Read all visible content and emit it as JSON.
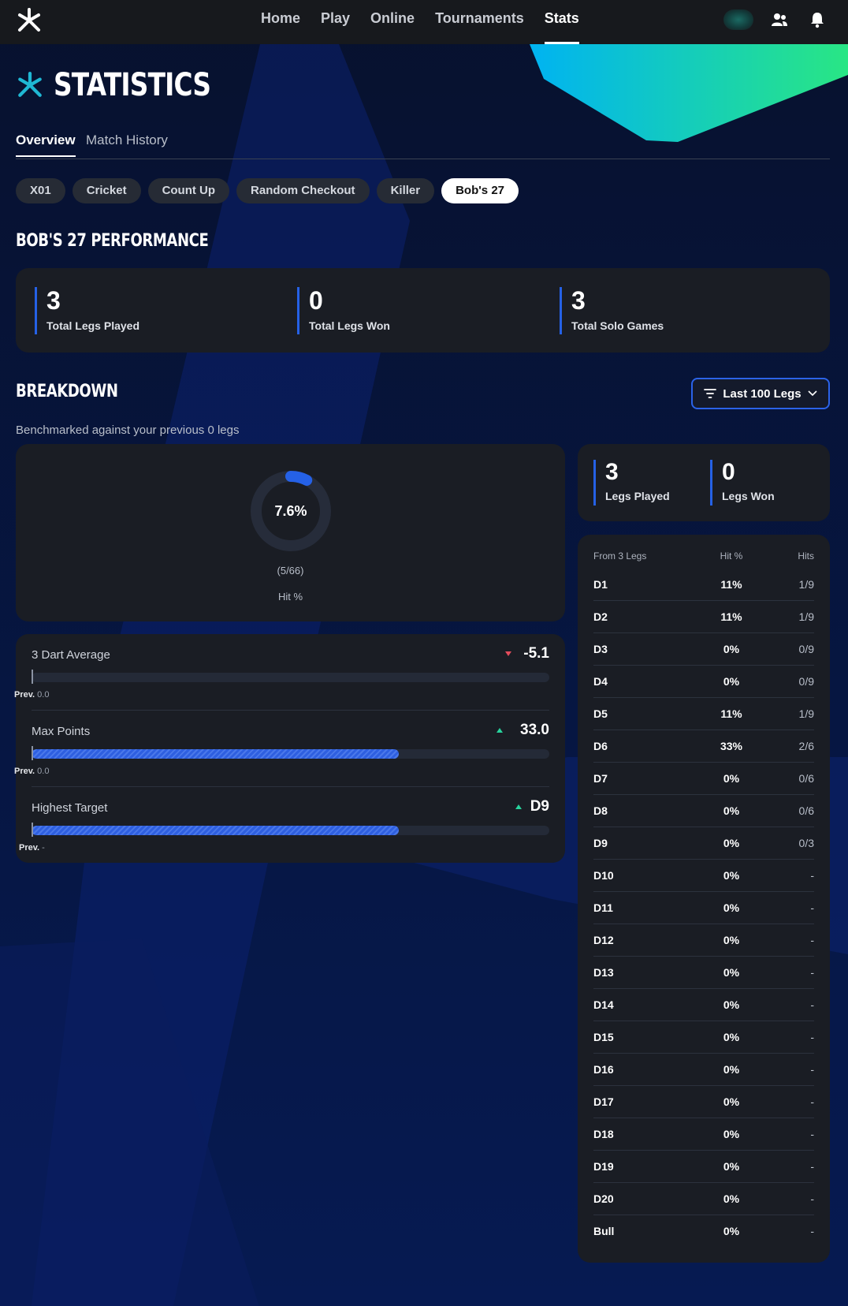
{
  "nav": {
    "items": [
      "Home",
      "Play",
      "Online",
      "Tournaments",
      "Stats"
    ],
    "active": "Stats",
    "icons": [
      "friends-icon",
      "bell-icon"
    ]
  },
  "page": {
    "title": "STATISTICS",
    "tabs": [
      "Overview",
      "Match History"
    ],
    "active_tab": "Overview",
    "game_chips": [
      "X01",
      "Cricket",
      "Count Up",
      "Random Checkout",
      "Killer",
      "Bob's 27"
    ],
    "active_chip": "Bob's 27"
  },
  "performance": {
    "title": "BOB'S 27 PERFORMANCE",
    "stats": [
      {
        "value": "3",
        "label": "Total Legs Played"
      },
      {
        "value": "0",
        "label": "Total Legs Won"
      },
      {
        "value": "3",
        "label": "Total Solo Games"
      }
    ]
  },
  "breakdown": {
    "title": "BREAKDOWN",
    "filter_label": "Last 100 Legs",
    "benchmark_text": "Benchmarked against your previous 0 legs",
    "hit_ring": {
      "percent_label": "7.6%",
      "fraction": 0.076,
      "count_label": "(5/66)",
      "caption": "Hit %"
    },
    "metrics": [
      {
        "name": "3 Dart Average",
        "value": "-5.1",
        "trend": "down",
        "fill": 0,
        "prev_label": "Prev.",
        "prev_value": "0.0"
      },
      {
        "name": "Max Points",
        "value": "33.0",
        "trend": "up",
        "fill": 0.71,
        "prev_label": "Prev.",
        "prev_value": "0.0"
      },
      {
        "name": "Highest Target",
        "value": "D9",
        "trend": "up",
        "fill": 0.71,
        "prev_label": "Prev.",
        "prev_value": "-"
      }
    ],
    "legs": [
      {
        "value": "3",
        "label": "Legs Played"
      },
      {
        "value": "0",
        "label": "Legs Won"
      }
    ],
    "table": {
      "headers": [
        "From 3 Legs",
        "Hit %",
        "Hits"
      ],
      "rows": [
        [
          "D1",
          "11%",
          "1/9"
        ],
        [
          "D2",
          "11%",
          "1/9"
        ],
        [
          "D3",
          "0%",
          "0/9"
        ],
        [
          "D4",
          "0%",
          "0/9"
        ],
        [
          "D5",
          "11%",
          "1/9"
        ],
        [
          "D6",
          "33%",
          "2/6"
        ],
        [
          "D7",
          "0%",
          "0/6"
        ],
        [
          "D8",
          "0%",
          "0/6"
        ],
        [
          "D9",
          "0%",
          "0/3"
        ],
        [
          "D10",
          "0%",
          "-"
        ],
        [
          "D11",
          "0%",
          "-"
        ],
        [
          "D12",
          "0%",
          "-"
        ],
        [
          "D13",
          "0%",
          "-"
        ],
        [
          "D14",
          "0%",
          "-"
        ],
        [
          "D15",
          "0%",
          "-"
        ],
        [
          "D16",
          "0%",
          "-"
        ],
        [
          "D17",
          "0%",
          "-"
        ],
        [
          "D18",
          "0%",
          "-"
        ],
        [
          "D19",
          "0%",
          "-"
        ],
        [
          "D20",
          "0%",
          "-"
        ],
        [
          "Bull",
          "0%",
          "-"
        ]
      ]
    }
  },
  "colors": {
    "accent": "#2561e6",
    "card": "#1a1d24",
    "up": "#28d39d",
    "down": "#e34c5c"
  }
}
